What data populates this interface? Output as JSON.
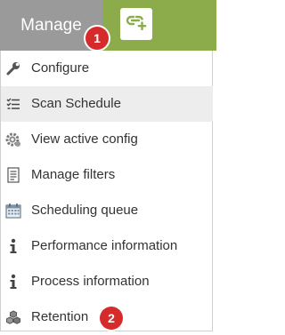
{
  "header": {
    "title": "Manage"
  },
  "badges": [
    "1",
    "2"
  ],
  "menu": {
    "items": [
      {
        "label": "Configure",
        "icon": "wrench-icon"
      },
      {
        "label": "Scan Schedule",
        "icon": "list-check-icon"
      },
      {
        "label": "View active config",
        "icon": "gear-icon"
      },
      {
        "label": "Manage filters",
        "icon": "document-icon"
      },
      {
        "label": "Scheduling queue",
        "icon": "calendar-icon"
      },
      {
        "label": "Performance information",
        "icon": "info-icon"
      },
      {
        "label": "Process information",
        "icon": "info-icon"
      },
      {
        "label": "Retention",
        "icon": "cubes-icon"
      }
    ]
  },
  "colors": {
    "manage_tab": "#9a9a9a",
    "toolbar_green": "#8cab4a",
    "badge_red": "#d62b2b",
    "active_item": "#ededed"
  }
}
